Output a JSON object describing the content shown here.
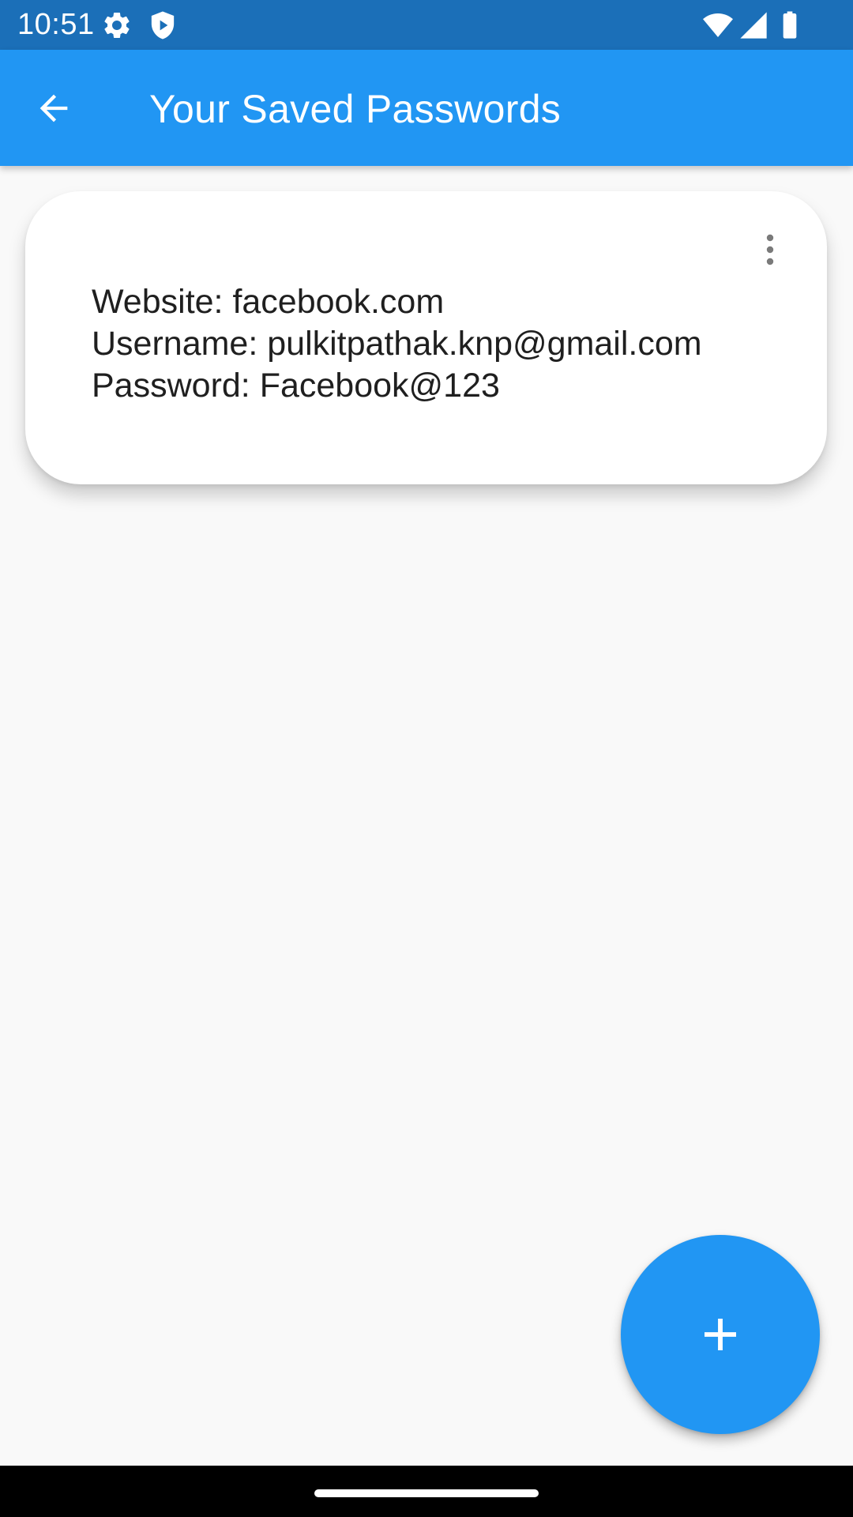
{
  "status_bar": {
    "time": "10:51",
    "icons": [
      "settings-icon",
      "shield-play-icon",
      "wifi-icon",
      "cellular-signal-icon",
      "battery-icon"
    ]
  },
  "app_bar": {
    "title": "Your Saved Passwords",
    "back_icon": "arrow-back-icon",
    "background": "#2196f3"
  },
  "entries": [
    {
      "website": "Website: facebook.com",
      "username": "Username: pulkitpathak.knp@gmail.com",
      "password": "Password: Facebook@123",
      "menu_icon": "more-vert-icon"
    }
  ],
  "fab": {
    "icon": "add-icon",
    "color": "#2196f3"
  },
  "colors": {
    "status_bar": "#1b6fb8",
    "accent": "#2196f3",
    "background": "#f9f9f9"
  }
}
